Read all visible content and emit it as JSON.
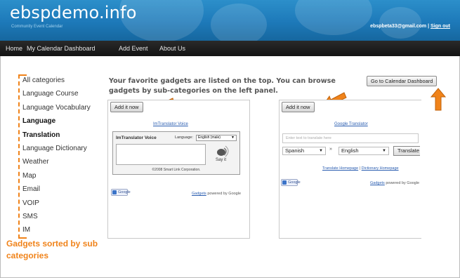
{
  "header": {
    "site_title": "ebspdemo.info",
    "tagline": "Community Event Calendar",
    "account_email": "ebspbeta33@gmail.com",
    "separator": "|",
    "sign_out": "Sign out"
  },
  "nav": {
    "items": [
      "Home",
      "My Calendar Dashboard",
      "Add Event",
      "About Us"
    ]
  },
  "sidebar": {
    "categories": [
      {
        "label": "All categories",
        "selected": false
      },
      {
        "label": "Language Course",
        "selected": false
      },
      {
        "label": "Language Vocabulary",
        "selected": false
      },
      {
        "label": "Language",
        "selected": true
      },
      {
        "label": "Translation",
        "selected": true
      },
      {
        "label": "Language Dictionary",
        "selected": false
      },
      {
        "label": "Weather",
        "selected": false
      },
      {
        "label": "Map",
        "selected": false
      },
      {
        "label": "Email",
        "selected": false
      },
      {
        "label": "VOIP",
        "selected": false
      },
      {
        "label": "SMS",
        "selected": false
      },
      {
        "label": "IM",
        "selected": false
      }
    ],
    "caption_line1": "Gadgets sorted by sub",
    "caption_line2": "categories"
  },
  "main": {
    "intro_text": "Your favorite gadgets are listed on the top. You can browse gadgets by sub-categories on the left panel.",
    "dashboard_button": "Go to Calendar Dashboard",
    "gadget1": {
      "add_button": "Add it now",
      "link": "ImTranslator Voice",
      "box_title": "ImTranslator Voice",
      "language_label": "Language:",
      "language_value": "English (male)",
      "say_it": "Say it",
      "copyright": "©2008 Smart Link Corporation.",
      "badge": "Google",
      "powered_link": "Gadgets",
      "powered_text": "powered by Google"
    },
    "gadget2": {
      "add_button": "Add it now",
      "link": "Google Translator",
      "input_placeholder": "Enter text to translate here",
      "from_lang": "Spanish",
      "swap": "»",
      "to_lang": "English",
      "translate_button": "Translate",
      "homepage_link": "Translate Homepage",
      "pipe": "|",
      "dictionary_link": "Dictionary Homepage",
      "badge": "Google",
      "powered_link": "Gadgets",
      "powered_text": "powered by Google"
    }
  },
  "colors": {
    "header_blue": "#1d79b9",
    "nav_black": "#1c1c1c",
    "annotation_orange": "#f0831a",
    "link_blue": "#2a5db0"
  },
  "icons": [
    "speaker-icon",
    "dropdown-arrow-icon",
    "google-badge-icon",
    "annotation-arrow-icon"
  ]
}
